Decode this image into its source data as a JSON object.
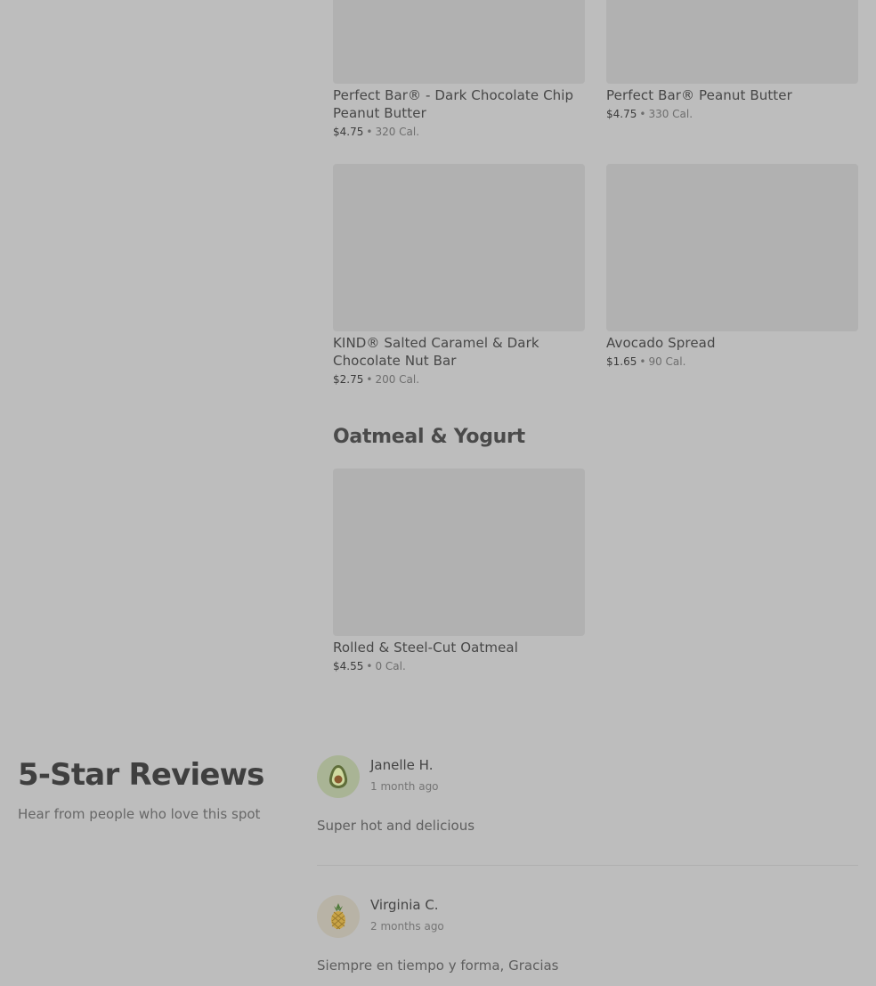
{
  "menu": {
    "items": [
      {
        "name": "Perfect Bar® - Dark Chocolate Chip Peanut Butter",
        "price": "$4.75",
        "calories": "320 Cal."
      },
      {
        "name": "Perfect Bar® Peanut Butter",
        "price": "$4.75",
        "calories": "330 Cal."
      },
      {
        "name": "KIND® Salted Caramel & Dark Chocolate Nut Bar",
        "price": "$2.75",
        "calories": "200 Cal."
      },
      {
        "name": "Avocado Spread",
        "price": "$1.65",
        "calories": "90 Cal."
      }
    ],
    "oatmeal_section": {
      "title": "Oatmeal & Yogurt",
      "items": [
        {
          "name": "Rolled & Steel-Cut Oatmeal",
          "price": "$4.55",
          "calories": "0 Cal."
        }
      ]
    },
    "separator": "•"
  },
  "reviews": {
    "title": "5-Star Reviews",
    "subtitle": "Hear from people who love this spot",
    "list": [
      {
        "name": "Janelle H.",
        "time": "1 month ago",
        "text": "Super hot and delicious",
        "avatar_icon": "avocado-icon"
      },
      {
        "name": "Virginia C.",
        "time": "2 months ago",
        "text": "Siempre en tiempo y forma, Gracias",
        "avatar_icon": "pineapple-icon"
      }
    ]
  }
}
